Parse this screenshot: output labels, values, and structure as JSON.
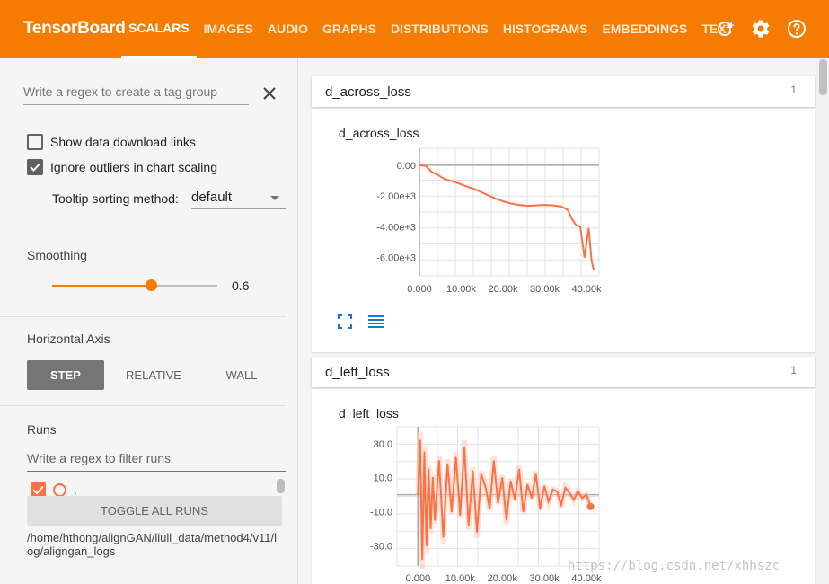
{
  "app": {
    "brand": "TensorBoard"
  },
  "nav": {
    "tabs": [
      {
        "label": "SCALARS",
        "active": true
      },
      {
        "label": "IMAGES"
      },
      {
        "label": "AUDIO"
      },
      {
        "label": "GRAPHS"
      },
      {
        "label": "DISTRIBUTIONS"
      },
      {
        "label": "HISTOGRAMS"
      },
      {
        "label": "EMBEDDINGS"
      },
      {
        "label": "TEXT"
      }
    ],
    "icons": [
      "refresh-icon",
      "settings-icon",
      "help-icon"
    ]
  },
  "sidebar": {
    "tag_group_placeholder": "Write a regex to create a tag group",
    "show_download_links": {
      "label": "Show data download links",
      "checked": false
    },
    "ignore_outliers": {
      "label": "Ignore outliers in chart scaling",
      "checked": true
    },
    "tooltip_sorting": {
      "label": "Tooltip sorting method:",
      "value": "default"
    },
    "smoothing": {
      "title": "Smoothing",
      "value": "0.6",
      "fraction": 0.6
    },
    "horizontal_axis": {
      "title": "Horizontal Axis",
      "options": [
        "STEP",
        "RELATIVE",
        "WALL"
      ],
      "selected": "STEP"
    },
    "runs": {
      "title": "Runs",
      "filter_placeholder": "Write a regex to filter runs",
      "items": [
        {
          "label": ".",
          "checked": true
        }
      ],
      "toggle_all_label": "TOGGLE ALL RUNS",
      "logdir": "/home/hthong/alignGAN/liuli_data/method4/v11/log/aligngan_logs"
    }
  },
  "cards": [
    {
      "name": "d_across_loss",
      "count": "1",
      "chart_title": "d_across_loss"
    },
    {
      "name": "d_left_loss",
      "count": "1",
      "chart_title": "d_left_loss"
    }
  ],
  "colors": {
    "accent": "#f57c00",
    "series": "#ff7043",
    "toolbar_icon": "#1976d2"
  },
  "watermark": "https://blog.csdn.net/xhhszc",
  "chart_data": [
    {
      "type": "line",
      "title": "d_across_loss",
      "x_ticks": [
        "0.000",
        "10.00k",
        "20.00k",
        "30.00k",
        "40.00k"
      ],
      "y_ticks": [
        "0.00",
        "-2.00e+3",
        "-4.00e+3",
        "-6.00e+3"
      ],
      "xlim": [
        0,
        43000
      ],
      "ylim": [
        -7200,
        1100
      ],
      "series": [
        {
          "color": "#ff7043",
          "x": [
            0,
            1500,
            3000,
            4500,
            6000,
            8000,
            10000,
            12000,
            14000,
            16000,
            18000,
            20000,
            22000,
            24000,
            26000,
            28000,
            30000,
            32000,
            34000,
            35500,
            36500,
            37500,
            38500,
            39500,
            40500,
            41200,
            41600,
            42000
          ],
          "y": [
            0,
            -50,
            -450,
            -650,
            -900,
            -1050,
            -1250,
            -1450,
            -1650,
            -1900,
            -2150,
            -2350,
            -2500,
            -2600,
            -2650,
            -2620,
            -2580,
            -2620,
            -2700,
            -2900,
            -3500,
            -3900,
            -4000,
            -6000,
            -4100,
            -6200,
            -6700,
            -6850
          ]
        }
      ]
    },
    {
      "type": "line",
      "title": "d_left_loss",
      "x_ticks": [
        "0.000",
        "10.00k",
        "20.00k",
        "30.00k",
        "40.00k"
      ],
      "y_ticks": [
        "30.0",
        "10.0",
        "-10.0",
        "-30.0"
      ],
      "xlim": [
        -5000,
        43000
      ],
      "ylim": [
        -42,
        40
      ],
      "series": [
        {
          "color": "#ff7043",
          "x": [
            0,
            500,
            1000,
            1500,
            2000,
            2500,
            3000,
            3500,
            4000,
            5000,
            6000,
            7000,
            8000,
            9000,
            10000,
            11000,
            12000,
            13000,
            14000,
            15000,
            16000,
            17000,
            18000,
            19000,
            20000,
            21000,
            22000,
            23000,
            24000,
            25000,
            26000,
            27000,
            28000,
            29000,
            30000,
            31000,
            32000,
            33000,
            34000,
            35000,
            36000,
            37000,
            38000,
            39000,
            40000,
            41000
          ],
          "y": [
            0,
            32,
            -38,
            25,
            -30,
            15,
            -20,
            10,
            -15,
            20,
            -25,
            18,
            -10,
            22,
            -12,
            28,
            -18,
            14,
            -22,
            12,
            5,
            -8,
            20,
            -5,
            10,
            -15,
            8,
            -3,
            15,
            -10,
            6,
            -2,
            12,
            -8,
            5,
            -4,
            3,
            2,
            -6,
            4,
            1,
            -3,
            2,
            -2,
            0,
            -7
          ]
        }
      ]
    }
  ]
}
